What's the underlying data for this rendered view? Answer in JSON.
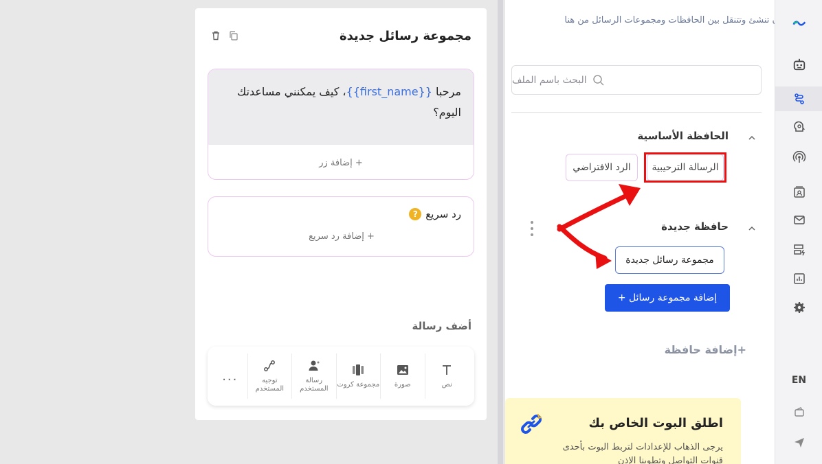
{
  "sidebar": {
    "hint": "يمكنك أن تنشئ وتتنقل بين الحافظات ومجموعات الرسائل من هنا",
    "search_placeholder": "البحث باسم الملف",
    "folders": [
      {
        "title": "الحافظة الأساسية",
        "chips": [
          "الرسالة الترحيبية",
          "الرد الافتراضي"
        ]
      },
      {
        "title": "حافظة جديدة",
        "chips": [
          "مجموعة رسائل جديدة"
        ]
      }
    ],
    "add_group_label": "إضافة مجموعة رسائل +",
    "add_folder_label": "+إضافة حافظة",
    "promo": {
      "title": "اطلق البوت الخاص بك",
      "text": "يرجى الذهاب للإعدادات لتربط البوت بأحدى قنوات التواصل وتطوينا الإذن"
    }
  },
  "rail": {
    "lang": "EN"
  },
  "card": {
    "title": "مجموعة رسائل جديدة",
    "message": {
      "prefix": "مرحبا ",
      "variable": "{{first_name}}",
      "suffix": "، كيف يمكنني مساعدتك اليوم؟"
    },
    "add_button_label": "+ إضافة زر",
    "quick_reply_title": "رد سريع",
    "quick_reply_help": "?",
    "add_quick_reply_label": "+ إضافة رد سريع",
    "add_message_label": "أضف رسالة",
    "toolbar": {
      "items": [
        "نص",
        "صورة",
        "مجموعة كروت",
        "رسالة المستخدم",
        "توجيه المستخدم"
      ],
      "more": "..."
    }
  },
  "colors": {
    "accent": "#1f55e6",
    "highlight": "#e81010",
    "promo_bg": "#fff8c8"
  }
}
